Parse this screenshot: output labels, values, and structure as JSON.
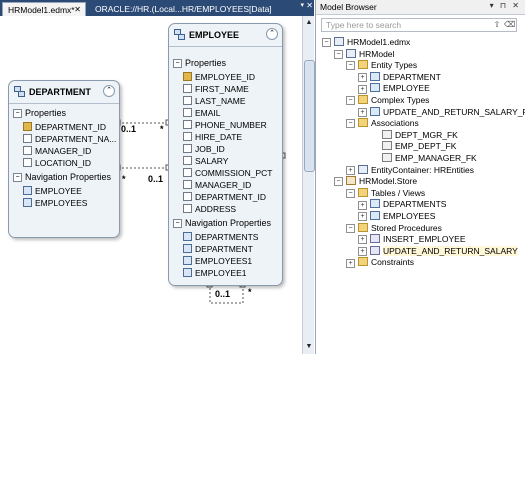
{
  "tabs": [
    {
      "label": "HRModel1.edmx*",
      "active": true
    },
    {
      "label": "ORACLE://HR.(Local...HR/EMPLOYEES[Data]",
      "active": false
    }
  ],
  "tab_controls": {
    "dropdown": "▾",
    "close": "✕"
  },
  "designer": {
    "entities": {
      "department": {
        "title": "DEPARTMENT",
        "sections": {
          "properties": "Properties",
          "navigation": "Navigation Properties"
        },
        "properties": [
          "DEPARTMENT_ID",
          "DEPARTMENT_NA...",
          "MANAGER_ID",
          "LOCATION_ID"
        ],
        "nav_properties": [
          "EMPLOYEE",
          "EMPLOYEES"
        ]
      },
      "employee": {
        "title": "EMPLOYEE",
        "sections": {
          "properties": "Properties",
          "navigation": "Navigation Properties"
        },
        "properties": [
          "EMPLOYEE_ID",
          "FIRST_NAME",
          "LAST_NAME",
          "EMAIL",
          "PHONE_NUMBER",
          "HIRE_DATE",
          "JOB_ID",
          "SALARY",
          "COMMISSION_PCT",
          "MANAGER_ID",
          "DEPARTMENT_ID",
          "ADDRESS"
        ],
        "nav_properties": [
          "DEPARTMENTS",
          "DEPARTMENT",
          "EMPLOYEES1",
          "EMPLOYEE1"
        ]
      }
    },
    "associations": [
      {
        "left": "0..1",
        "right": "*"
      },
      {
        "left": "*",
        "right": "0..1"
      },
      {
        "left": "0..1",
        "right": "*"
      }
    ]
  },
  "model_browser": {
    "title": "Model Browser",
    "title_buttons": "▾ ⊓ ✕",
    "search_placeholder": "Type here to search",
    "tree": [
      {
        "label": "HRModel1.edmx",
        "expander": "−",
        "icon": "model"
      },
      {
        "label": "HRModel",
        "expander": "−",
        "icon": "model"
      },
      {
        "label": "Entity Types",
        "expander": "−",
        "icon": "folder"
      },
      {
        "label": "DEPARTMENT",
        "expander": "+",
        "icon": "entity"
      },
      {
        "label": "EMPLOYEE",
        "expander": "+",
        "icon": "entity"
      },
      {
        "label": "Complex Types",
        "expander": "−",
        "icon": "folder"
      },
      {
        "label": "UPDATE_AND_RETURN_SALARY_Result",
        "expander": "+",
        "icon": "entity"
      },
      {
        "label": "Associations",
        "expander": "−",
        "icon": "folder"
      },
      {
        "label": "DEPT_MGR_FK",
        "expander": "",
        "icon": "assoc"
      },
      {
        "label": "EMP_DEPT_FK",
        "expander": "",
        "icon": "assoc"
      },
      {
        "label": "EMP_MANAGER_FK",
        "expander": "",
        "icon": "assoc"
      },
      {
        "label": "EntityContainer: HREntities",
        "expander": "+",
        "icon": "model"
      },
      {
        "label": "HRModel.Store",
        "expander": "−",
        "icon": "db"
      },
      {
        "label": "Tables / Views",
        "expander": "−",
        "icon": "folder"
      },
      {
        "label": "DEPARTMENTS",
        "expander": "+",
        "icon": "entity"
      },
      {
        "label": "EMPLOYEES",
        "expander": "+",
        "icon": "entity"
      },
      {
        "label": "Stored Procedures",
        "expander": "−",
        "icon": "folder"
      },
      {
        "label": "INSERT_EMPLOYEE",
        "expander": "+",
        "icon": "proc"
      },
      {
        "label": "UPDATE_AND_RETURN_SALARY",
        "expander": "+",
        "icon": "proc",
        "selected": true
      },
      {
        "label": "Constraints",
        "expander": "+",
        "icon": "folder"
      }
    ]
  }
}
